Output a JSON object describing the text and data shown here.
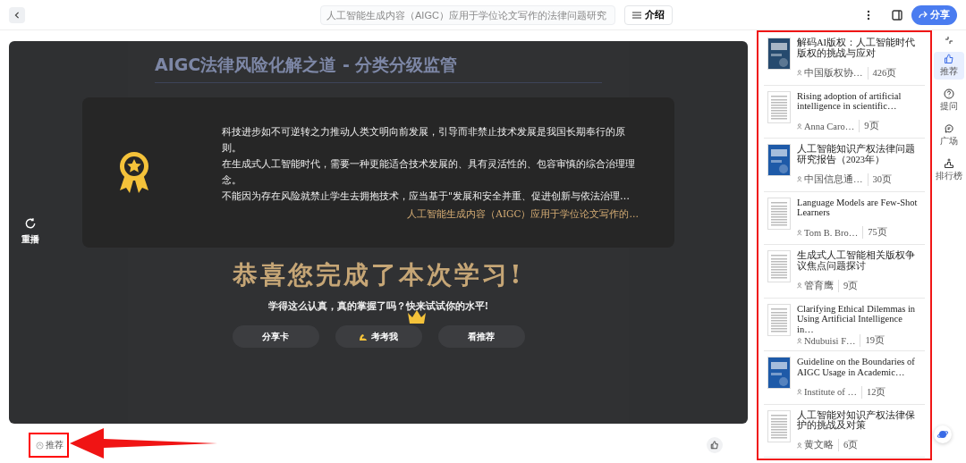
{
  "topbar": {
    "search_placeholder": "人工智能生成内容（AIGC）应用于学位论文写作的法律问题研究",
    "intro_button": "介绍",
    "share_button": "分享"
  },
  "slide": {
    "heading": "AIGC法律风险化解之道 - 分类分级监管",
    "replay_label": "重播"
  },
  "overlay": {
    "quote_lines": [
      "科技进步如不可逆转之力推动人类文明向前发展，引导而非禁止技术发展是我国长期奉行的原则。",
      "在生成式人工智能时代，需要一种更能适合技术发展的、具有灵活性的、包容审慎的综合治理理念。",
      "不能因为存在风险就禁止学生去拥抱技术，应当基于\"发展和安全并重、促进创新与依法治理…"
    ],
    "source": "人工智能生成内容（AIGC）应用于学位论文写作的…",
    "congrats": "恭喜您完成了本次学习!",
    "subtitle": "学得这么认真，真的掌握了吗？快来试试你的水平!",
    "buttons": [
      {
        "label": "分享卡",
        "kind": "plain"
      },
      {
        "label": "考考我",
        "kind": "arm"
      },
      {
        "label": "看推荐",
        "kind": "plain"
      }
    ]
  },
  "recommend_button": "推荐",
  "sidebar": {
    "items": [
      {
        "title": "解码AI版权：人工智能时代版权的挑战与应对",
        "author": "中国版权协…",
        "pages": "426页",
        "kind": "dark"
      },
      {
        "title": "Rising adoption of artificial intelligence in scientific…",
        "author": "Anna Caro…",
        "pages": "9页",
        "kind": "paper"
      },
      {
        "title": "人工智能知识产权法律问题研究报告（2023年）",
        "author": "中国信息通…",
        "pages": "30页",
        "kind": "blue"
      },
      {
        "title": "Language Models are Few-Shot Learners",
        "author": "Tom B. Bro…",
        "pages": "75页",
        "kind": "paper"
      },
      {
        "title": "生成式人工智能相关版权争议焦点问题探讨",
        "author": "管育鹰",
        "pages": "9页",
        "kind": "paper"
      },
      {
        "title": "Clarifying Ethical Dilemmas in Using Artificial Intelligence in…",
        "author": "Ndubuisi F…",
        "pages": "19页",
        "kind": "paper"
      },
      {
        "title": "Guideline on the Boundaries of AIGC Usage in Academic…",
        "author": "Institute of …",
        "pages": "12页",
        "kind": "blue"
      },
      {
        "title": "人工智能对知识产权法律保护的挑战及对策",
        "author": "黄文略",
        "pages": "6页",
        "kind": "paper"
      }
    ]
  },
  "rail": [
    {
      "label": "推荐",
      "kind": "thumb",
      "selected": true
    },
    {
      "label": "提问",
      "kind": "question",
      "selected": false
    },
    {
      "label": "广场",
      "kind": "chat",
      "selected": false
    },
    {
      "label": "排行榜",
      "kind": "rank",
      "selected": false
    }
  ]
}
